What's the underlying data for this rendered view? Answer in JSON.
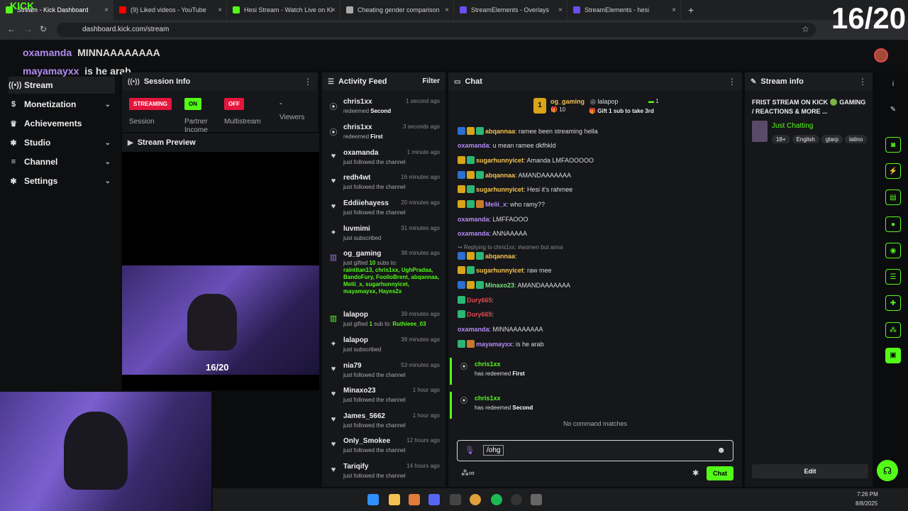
{
  "browser": {
    "tabs": [
      {
        "title": "Stream - Kick Dashboard",
        "favicon_color": "#53fc18",
        "active": true
      },
      {
        "title": "(9) Liked videos - YouTube",
        "favicon_color": "#ff0000",
        "active": false
      },
      {
        "title": "Hesi Stream - Watch Live on Ki",
        "favicon_color": "#53fc18",
        "active": false
      },
      {
        "title": "Cheating gender comparison",
        "favicon_color": "#aaaaaa",
        "active": false
      },
      {
        "title": "StreamElements - Overlays",
        "favicon_color": "#6b4df0",
        "active": false
      },
      {
        "title": "StreamElements - hesi",
        "favicon_color": "#6b4df0",
        "active": false
      }
    ],
    "new_tab": "+",
    "url": "dashboard.kick.com/stream"
  },
  "overlay": {
    "counter": "16/20",
    "cam_counter": "16/20",
    "banner_line1_user": "oxamanda",
    "banner_line1_msg": "MINNAAAAAAAA",
    "banner_line2_user": "mayamayxx",
    "banner_line2_msg": "is he arab",
    "logo_text": "KICK"
  },
  "sidebar": {
    "items": [
      {
        "label": "Stream",
        "icon": "broadcast-icon",
        "glyph": "((•))",
        "has_chevron": false
      },
      {
        "label": "Monetization",
        "icon": "money-icon",
        "glyph": "$",
        "has_chevron": true
      },
      {
        "label": "Achievements",
        "icon": "trophy-icon",
        "glyph": "♛",
        "has_chevron": false
      },
      {
        "label": "Studio",
        "icon": "gear-icon",
        "glyph": "✱",
        "has_chevron": true
      },
      {
        "label": "Channel",
        "icon": "menu-icon",
        "glyph": "≡",
        "has_chevron": true
      },
      {
        "label": "Settings",
        "icon": "gear-icon",
        "glyph": "✱",
        "has_chevron": true
      }
    ]
  },
  "session": {
    "title": "Session Info",
    "streaming": "STREAMING",
    "session_label": "Session",
    "partner_badge": "ON",
    "partner_label": "Partner Income",
    "multistream_badge": "OFF",
    "multistream_label": "Multistream",
    "viewers_value": "-",
    "viewers_label": "Viewers",
    "preview_title": "Stream Preview"
  },
  "activity": {
    "title": "Activity Feed",
    "filter": "Filter",
    "items": [
      {
        "icon": "points-icon",
        "glyph": "⦿",
        "name": "chris1xx",
        "time": "1 second ago",
        "pre": "redeemed ",
        "hl": "Second",
        "post": ""
      },
      {
        "icon": "points-icon",
        "glyph": "⦿",
        "name": "chris1xx",
        "time": "3 seconds ago",
        "pre": "redeemed ",
        "hl": "First",
        "post": ""
      },
      {
        "icon": "heart-icon",
        "glyph": "♥",
        "name": "oxamanda",
        "time": "1 minute ago",
        "pre": "just followed the channel",
        "hl": "",
        "post": ""
      },
      {
        "icon": "heart-icon",
        "glyph": "♥",
        "name": "redh4wt",
        "time": "16 minutes ago",
        "pre": "just followed the channel",
        "hl": "",
        "post": ""
      },
      {
        "icon": "heart-icon",
        "glyph": "♥",
        "name": "Eddiiehayess",
        "time": "20 minutes ago",
        "pre": "just followed the channel",
        "hl": "",
        "post": ""
      },
      {
        "icon": "star-icon",
        "glyph": "✦",
        "name": "luvmimi",
        "time": "31 minutes ago",
        "pre": "just subscribed",
        "hl": "",
        "post": ""
      }
    ],
    "gift": {
      "name": "og_gaming",
      "time": "38 minutes ago",
      "pre": "just gifted ",
      "count": "10",
      "post": " subs to:",
      "recipients": "raintitan13, chris1xx, UghPradaa, BandoFury, FoolioBrent, abqannaa, Melii_x, sugarhunnyicet, mayamayxx, Hayes2x"
    },
    "gift2": {
      "name": "lalapop",
      "time": "39 minutes ago",
      "pre": "just gifted ",
      "count": "1",
      "post": " sub to: ",
      "recipient": "Ruthieee_03"
    },
    "items2": [
      {
        "icon": "star-icon",
        "glyph": "✦",
        "name": "lalapop",
        "time": "39 minutes ago",
        "sub": "just subscribed"
      },
      {
        "icon": "heart-icon",
        "glyph": "♥",
        "name": "nia79",
        "time": "53 minutes ago",
        "sub": "just followed the channel"
      },
      {
        "icon": "heart-icon",
        "glyph": "♥",
        "name": "Minaxo23",
        "time": "1 hour ago",
        "sub": "just followed the channel"
      },
      {
        "icon": "heart-icon",
        "glyph": "♥",
        "name": "James_5662",
        "time": "1 hour ago",
        "sub": "just followed the channel"
      },
      {
        "icon": "heart-icon",
        "glyph": "♥",
        "name": "Only_Smokee",
        "time": "12 hours ago",
        "sub": "just followed the channel"
      },
      {
        "icon": "heart-icon",
        "glyph": "♥",
        "name": "Tariqify",
        "time": "14 hours ago",
        "sub": "just followed the channel"
      }
    ]
  },
  "chat": {
    "title": "Chat",
    "pinned": {
      "gifter1": "og_gaming",
      "gifter1_count": "10",
      "gifter1_rank": "1",
      "gifter2": "lalapop",
      "gifter2_count": "1",
      "cta": "Gift 1 sub to take 3rd"
    },
    "messages": [
      {
        "user": "abqannaa",
        "color": "#f5c451",
        "text": ": ramee been streaming hella",
        "badges": [
          "#2a6fd1",
          "#d9a419",
          "#2bb673"
        ]
      },
      {
        "user": "oxamanda",
        "color": "#b18cf2",
        "text": ": u mean ramee dkfhkld",
        "badges": []
      },
      {
        "user": "sugarhunnyicet",
        "color": "#f5c451",
        "text": ": Amanda LMFAOOOOO",
        "badges": [
          "#d9a419",
          "#2bb673"
        ]
      },
      {
        "user": "abqannaa",
        "color": "#f5c451",
        "text": ": AMANDAAAAAAA",
        "badges": [
          "#2a6fd1",
          "#d9a419",
          "#2bb673"
        ]
      },
      {
        "user": "sugarhunnyicet",
        "color": "#f5c451",
        "text": ": Hesi it's rahmee",
        "badges": [
          "#d9a419",
          "#2bb673"
        ]
      },
      {
        "user": "Melii_x",
        "color": "#b18cf2",
        "text": ": who ramy??",
        "badges": [
          "#d9a419",
          "#2bb673",
          "#c77a2b"
        ]
      },
      {
        "user": "oxamanda",
        "color": "#b18cf2",
        "text": ": LMFFAOOO",
        "badges": []
      },
      {
        "user": "oxamanda",
        "color": "#b18cf2",
        "text": ": ANNAAAAA",
        "badges": []
      }
    ],
    "reply_hint": "↪ Replying to chris1xx: #women but anna",
    "messages2": [
      {
        "user": "abqannaa",
        "color": "#f5c451",
        "text": ":",
        "badges": [
          "#2a6fd1",
          "#d9a419",
          "#2bb673"
        ]
      },
      {
        "user": "sugarhunnyicet",
        "color": "#f5c451",
        "text": ": raw mee",
        "badges": [
          "#d9a419",
          "#2bb673"
        ]
      },
      {
        "user": "Minaxo23",
        "color": "#7be07b",
        "text": ": AMANDAAAAAAA",
        "badges": [
          "#2a6fd1",
          "#d9a419",
          "#2bb673"
        ]
      },
      {
        "user": "Dury665",
        "color": "#e0494f",
        "text": ":",
        "badges": [
          "#2bb673"
        ]
      },
      {
        "user": "Dury665",
        "color": "#e0494f",
        "text": ":",
        "badges": [
          "#2bb673"
        ]
      },
      {
        "user": "oxamanda",
        "color": "#b18cf2",
        "text": ": MINNAAAAAAAA",
        "badges": []
      },
      {
        "user": "mayamayxx",
        "color": "#b18cf2",
        "text": ": is he arab",
        "badges": [
          "#2bb673",
          "#c77a2b"
        ]
      }
    ],
    "redeems": [
      {
        "user": "chris1xx",
        "pre": "has redeemed ",
        "reward": "First"
      },
      {
        "user": "chris1xx",
        "pre": "has redeemed ",
        "reward": "Second"
      }
    ],
    "no_match": "No command matches",
    "input_value": "/ohg",
    "send": "Chat"
  },
  "stream_info": {
    "title": "Stream info",
    "stream_title": "FRIST STREAM ON KICK 🟢 GAMING / REACTIONS & MORE ...",
    "category": "Just Chatting",
    "tags": [
      "18+",
      "English",
      "gtarp",
      "latino"
    ],
    "edit": "Edit"
  },
  "rail": [
    {
      "icon": "info-icon",
      "glyph": "i"
    },
    {
      "icon": "pencil-icon",
      "glyph": "✎"
    },
    {
      "icon": "camera-icon",
      "glyph": "◙"
    },
    {
      "icon": "lightning-icon",
      "glyph": "⚡"
    },
    {
      "icon": "document-icon",
      "glyph": "▤"
    },
    {
      "icon": "chat-icon",
      "glyph": "●"
    },
    {
      "icon": "broadcast-icon",
      "glyph": "◉"
    },
    {
      "icon": "list-icon",
      "glyph": "☰"
    },
    {
      "icon": "wrench-icon",
      "glyph": "✚"
    },
    {
      "icon": "users-icon",
      "glyph": "⁂"
    },
    {
      "icon": "app-icon",
      "glyph": "▣"
    }
  ],
  "taskbar": {
    "time": "7:26 PM",
    "date": "8/8/2025"
  },
  "colors": {
    "accent": "#53fc18",
    "live": "#e5163c",
    "bg": "#16171a"
  }
}
